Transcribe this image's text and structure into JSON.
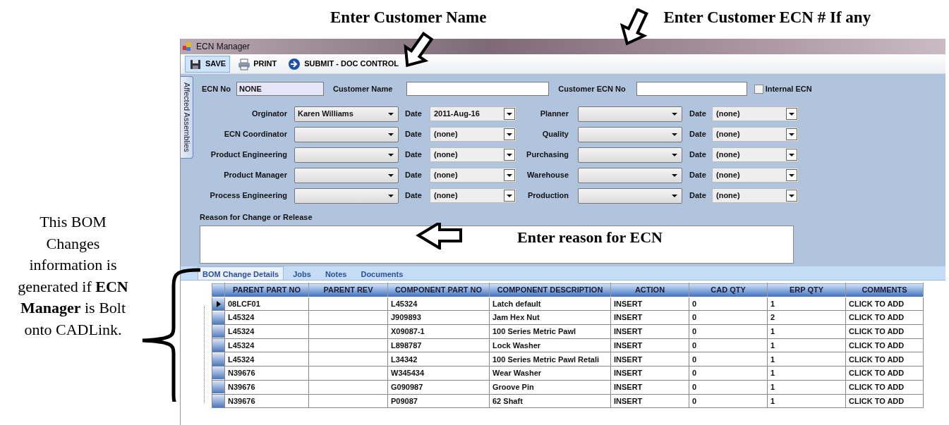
{
  "annotations": {
    "headings": [
      {
        "text": "Enter Customer Name"
      },
      {
        "text": "Enter Customer ECN # If any"
      }
    ],
    "reason_note": "Enter reason for ECN",
    "side_note": "This BOM Changes information is generated if **ECN Manager** is Bolt onto CADLink."
  },
  "window": {
    "title": "ECN Manager"
  },
  "toolbar": [
    {
      "kind": "save",
      "label": "SAVE",
      "selected": true
    },
    {
      "kind": "print",
      "label": "PRINT",
      "selected": false
    },
    {
      "kind": "submit",
      "label": "SUBMIT - DOC CONTROL",
      "selected": false
    }
  ],
  "side_tab": {
    "label": "Affected Assemblies"
  },
  "header_fields": {
    "ecn_no": {
      "label": "ECN No",
      "value": "NONE"
    },
    "customer_name": {
      "label": "Customer Name"
    },
    "customer_ecn_no": {
      "label": "Customer ECN No"
    },
    "internal_ecn": {
      "label": "Internal ECN",
      "checked": false
    }
  },
  "approvals": [
    [
      {
        "label": "Orginator",
        "value": "Karen Williams",
        "date_label": "Date",
        "date": "2011-Aug-16"
      },
      {
        "label": "Planner",
        "date_label": "Date",
        "date": "(none)"
      }
    ],
    [
      {
        "label": "ECN Coordinator",
        "date_label": "Date",
        "date": "(none)"
      },
      {
        "label": "Quality",
        "date_label": "Date",
        "date": "(none)"
      }
    ],
    [
      {
        "label": "Product Engineering",
        "date_label": "Date",
        "date": "(none)"
      },
      {
        "label": "Purchasing",
        "date_label": "Date",
        "date": "(none)"
      }
    ],
    [
      {
        "label": "Product Manager",
        "date_label": "Date",
        "date": "(none)"
      },
      {
        "label": "Warehouse",
        "date_label": "Date",
        "date": "(none)"
      }
    ],
    [
      {
        "label": "Process Engineering",
        "date_label": "Date",
        "date": "(none)"
      },
      {
        "label": "Production",
        "date_label": "Date",
        "date": "(none)"
      }
    ]
  ],
  "reason": {
    "label": "Reason for Change or Release"
  },
  "tabs": [
    {
      "label": "BOM Change Details",
      "selected": true
    },
    {
      "label": "Jobs",
      "selected": false
    },
    {
      "label": "Notes",
      "selected": false
    },
    {
      "label": "Documents",
      "selected": false
    }
  ],
  "table": {
    "columns": [
      "PARENT PART NO",
      "PARENT REV",
      "COMPONENT PART NO",
      "COMPONENT DESCRIPTION",
      "ACTION",
      "CAD QTY",
      "ERP QTY",
      "COMMENTS"
    ],
    "rows": [
      {
        "current": true,
        "parent_part_no": "08LCF01",
        "component_part_no": "L45324",
        "component_description": "Latch default",
        "action": "INSERT",
        "cad_qty": "0",
        "erp_qty": "1",
        "comments": "CLICK TO ADD"
      },
      {
        "current": false,
        "parent_part_no": "L45324",
        "component_part_no": "J909893",
        "component_description": "Jam Hex Nut",
        "action": "INSERT",
        "cad_qty": "0",
        "erp_qty": "2",
        "comments": "CLICK TO ADD"
      },
      {
        "current": false,
        "parent_part_no": "L45324",
        "component_part_no": "X09087-1",
        "component_description": "100 Series Metric Pawl",
        "action": "INSERT",
        "cad_qty": "0",
        "erp_qty": "1",
        "comments": "CLICK TO ADD"
      },
      {
        "current": false,
        "parent_part_no": "L45324",
        "component_part_no": "L898787",
        "component_description": "Lock Washer",
        "action": "INSERT",
        "cad_qty": "0",
        "erp_qty": "1",
        "comments": "CLICK TO ADD"
      },
      {
        "current": false,
        "parent_part_no": "L45324",
        "component_part_no": "L34342",
        "component_description": "100 Series Metric Pawl Retali",
        "action": "INSERT",
        "cad_qty": "0",
        "erp_qty": "1",
        "comments": "CLICK TO ADD"
      },
      {
        "current": false,
        "parent_part_no": "N39676",
        "component_part_no": "W345434",
        "component_description": "Wear Washer",
        "action": "INSERT",
        "cad_qty": "0",
        "erp_qty": "1",
        "comments": "CLICK TO ADD"
      },
      {
        "current": false,
        "parent_part_no": "N39676",
        "component_part_no": "G090987",
        "component_description": "Groove Pin",
        "action": "INSERT",
        "cad_qty": "0",
        "erp_qty": "1",
        "comments": "CLICK TO ADD"
      },
      {
        "current": false,
        "parent_part_no": "N39676",
        "component_part_no": "P09087",
        "component_description": "62 Shaft",
        "action": "INSERT",
        "cad_qty": "0",
        "erp_qty": "1",
        "comments": "CLICK TO ADD"
      }
    ]
  }
}
